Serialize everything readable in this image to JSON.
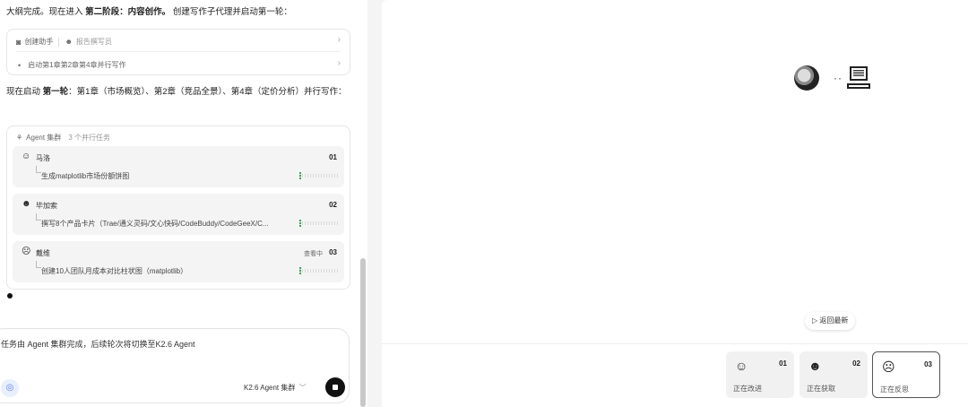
{
  "chat": {
    "intro": {
      "prefix": "大纲完成。现在进入",
      "bold": "第二阶段：内容创作。",
      "suffix": "创建写作子代理并启动第一轮："
    },
    "helper_card": {
      "create_label": "创建助手",
      "writer_label": "报告撰写员",
      "task_label": "启动第1章第2章第4章并行写作"
    },
    "round": {
      "prefix": "现在启动",
      "bold": "第一轮",
      "suffix": "：第1章（市场概览）、第2章（竞品全景）、第4章（定价分析）并行写作："
    },
    "cluster": {
      "title": "Agent 集群",
      "subtitle": "3 个并行任务",
      "agents": [
        {
          "name": "马洛",
          "num": "01",
          "status": "",
          "task": "生成matplotlib市场份额饼图",
          "progress": 0.05
        },
        {
          "name": "毕加索",
          "num": "02",
          "status": "",
          "task": "撰写8个产品卡片（Trae/通义灵码/文心快码/CodeBuddy/CodeGeeX/C...",
          "progress": 0.05
        },
        {
          "name": "戴维",
          "num": "03",
          "status": "查看中",
          "task": "创建10人团队月成本对比柱状图（matplotlib）",
          "progress": 0.05
        }
      ]
    }
  },
  "input": {
    "text": "任务由 Agent 集群完成，后续轮次将切换至K2.6 Agent",
    "model_label": "K2.6 Agent 集群",
    "model_chevron": "﹀"
  },
  "right": {
    "back_label": "▷ 返回最新",
    "bots": [
      {
        "num": "01",
        "status": "正在改进"
      },
      {
        "num": "02",
        "status": "正在获取"
      },
      {
        "num": "03",
        "status": "正在反思"
      }
    ]
  },
  "colors": {
    "accent": "#3aa35a",
    "send": "#111111"
  }
}
